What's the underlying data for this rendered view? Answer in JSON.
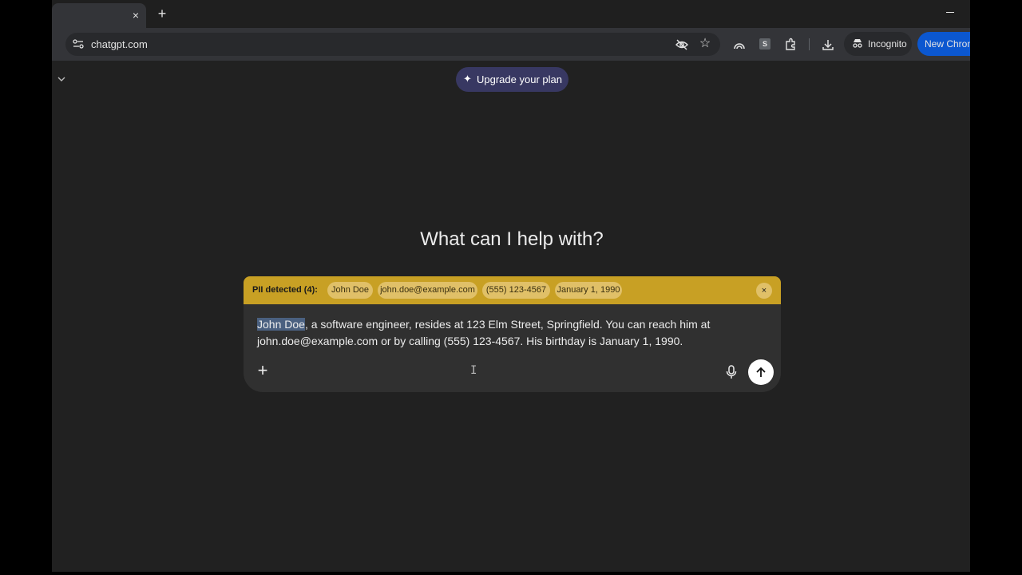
{
  "browser": {
    "tab_close_glyph": "×",
    "new_tab_glyph": "+",
    "url": "chatgpt.com",
    "incognito_label": "Incognito",
    "new_chrome_label": "New Chrome"
  },
  "page": {
    "upgrade_label": "Upgrade your plan",
    "headline": "What can I help with?"
  },
  "pii": {
    "title": "PII detected (4):",
    "chips": [
      "John Doe",
      "john.doe@example.com",
      "(555) 123-4567",
      "January 1, 1990"
    ],
    "close_glyph": "×"
  },
  "composer": {
    "highlighted": "John Doe",
    "text_rest": ", a software engineer, resides at 123 Elm Street, Springfield. You can reach him at john.doe@example.com or by calling (555) 123-4567. His birthday is January 1, 1990.",
    "plus_glyph": "+",
    "cursor_glyph": "I"
  },
  "colors": {
    "background": "#212121",
    "pii_banner": "#c8a024",
    "upgrade_button": "#383862",
    "composer": "#303030"
  },
  "icons": [
    "close-icon",
    "plus-icon",
    "minimize-icon",
    "site-info-icon",
    "eye-off-icon",
    "star-icon",
    "extension-icon",
    "puzzle-icon",
    "download-icon",
    "incognito-icon",
    "chevron-down-icon",
    "sparkle-icon",
    "mic-icon",
    "arrow-up-icon"
  ]
}
